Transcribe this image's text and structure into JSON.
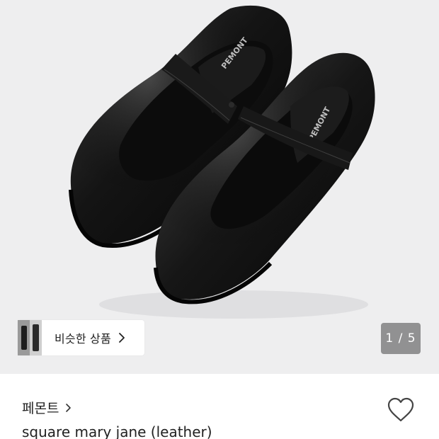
{
  "hero": {
    "image_alt": "black square-toe leather mary jane shoes",
    "strap_logo_text": "PEMONT"
  },
  "similar_products": {
    "label": "비슷한 상품",
    "chevron_icon": "chevron-right-icon"
  },
  "gallery": {
    "counter": "1 / 5"
  },
  "product": {
    "brand": "페몬트",
    "title": "square mary jane (leather)",
    "wishlist_icon": "heart-outline-icon"
  }
}
